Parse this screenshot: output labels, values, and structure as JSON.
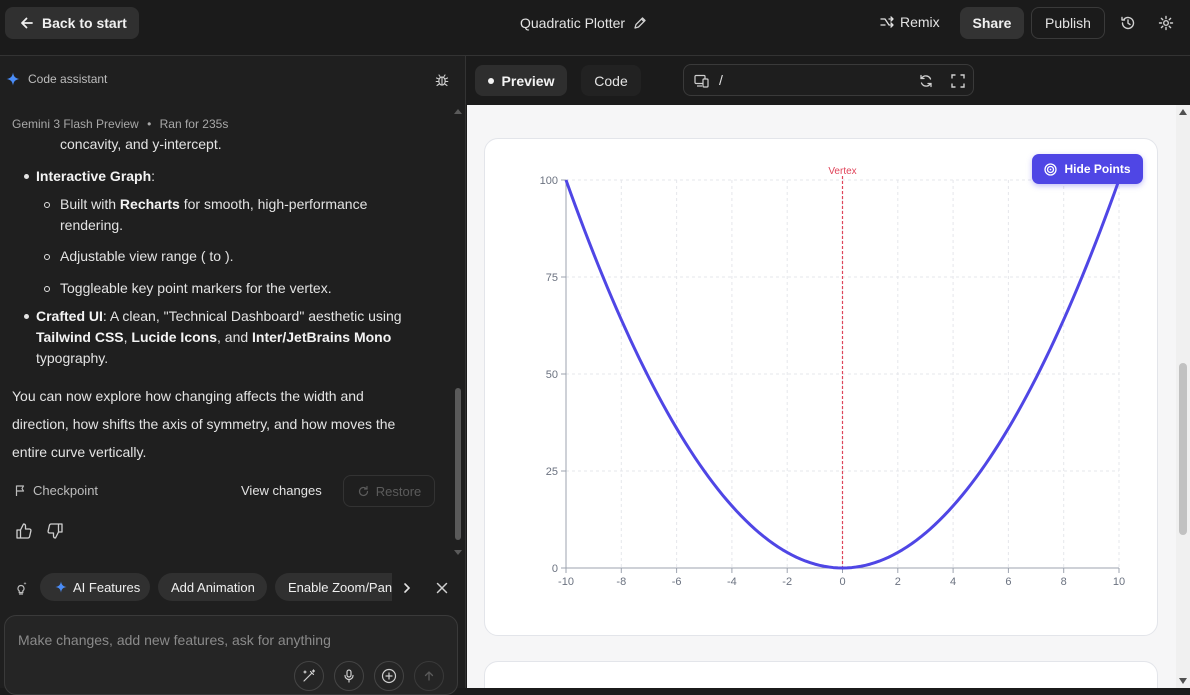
{
  "header": {
    "back_label": "Back to start",
    "title": "Quadratic Plotter",
    "remix_label": "Remix",
    "share_label": "Share",
    "publish_label": "Publish"
  },
  "assistant": {
    "title": "Code assistant",
    "model": "Gemini 3 Flash Preview",
    "separator": "•",
    "ran_for": "Ran for 235s",
    "lines": {
      "l0": "concavity, and y-intercept.",
      "l1_bold": "Interactive Graph",
      "l1_rest": ":",
      "l2_pre": "Built with ",
      "l2_bold": "Recharts",
      "l2_rest": " for smooth, high-performance",
      "l2b": "rendering.",
      "l3": "Adjustable view range ( to ).",
      "l4": "Toggleable key point markers for the vertex.",
      "l5_bold": "Crafted UI",
      "l5_rest": ": A clean, \"Technical Dashboard\" aesthetic using",
      "l6_b1": "Tailwind CSS",
      "l6_s1": ", ",
      "l6_b2": "Lucide Icons",
      "l6_s2": ", and ",
      "l6_b3": "Inter/JetBrains Mono",
      "l7": "typography.",
      "p1": "You can now explore how changing  affects the width and",
      "p2": "direction, how  shifts the axis of symmetry, and how  moves the",
      "p3": "entire curve vertically."
    },
    "checkpoint_label": "Checkpoint",
    "view_changes_label": "View changes",
    "restore_label": "Restore"
  },
  "suggestions": [
    "AI Features",
    "Add Animation",
    "Enable Zoom/Pan"
  ],
  "composer": {
    "placeholder": "Make changes, add new features, ask for anything"
  },
  "preview": {
    "tab_preview": "Preview",
    "tab_code": "Code",
    "url_path": "/",
    "hide_points_label": "Hide Points"
  },
  "chart_data": {
    "type": "line",
    "function": "y = x^2",
    "x_ticks": [
      "-10",
      "-8",
      "-6",
      "-4",
      "-2",
      "0",
      "2",
      "4",
      "6",
      "8",
      "10"
    ],
    "y_ticks": [
      "0",
      "25",
      "50",
      "75",
      "100"
    ],
    "xlim": [
      -10,
      10
    ],
    "ylim": [
      0,
      100
    ],
    "series": [
      {
        "x": [
          -10,
          -9,
          -8,
          -7,
          -6,
          -5,
          -4,
          -3,
          -2,
          -1,
          0,
          1,
          2,
          3,
          4,
          5,
          6,
          7,
          8,
          9,
          10
        ],
        "y": [
          100,
          81,
          64,
          49,
          36,
          25,
          16,
          9,
          4,
          1,
          0,
          1,
          4,
          9,
          16,
          25,
          36,
          49,
          64,
          81,
          100
        ]
      }
    ],
    "vertex": {
      "x": 0,
      "y": 0,
      "label": "Vertex"
    },
    "grid": true,
    "colors": {
      "line": "#4f46e5",
      "vertex": "#e0445a",
      "axis": "#9ca3af",
      "grid": "#e5e7eb"
    }
  }
}
